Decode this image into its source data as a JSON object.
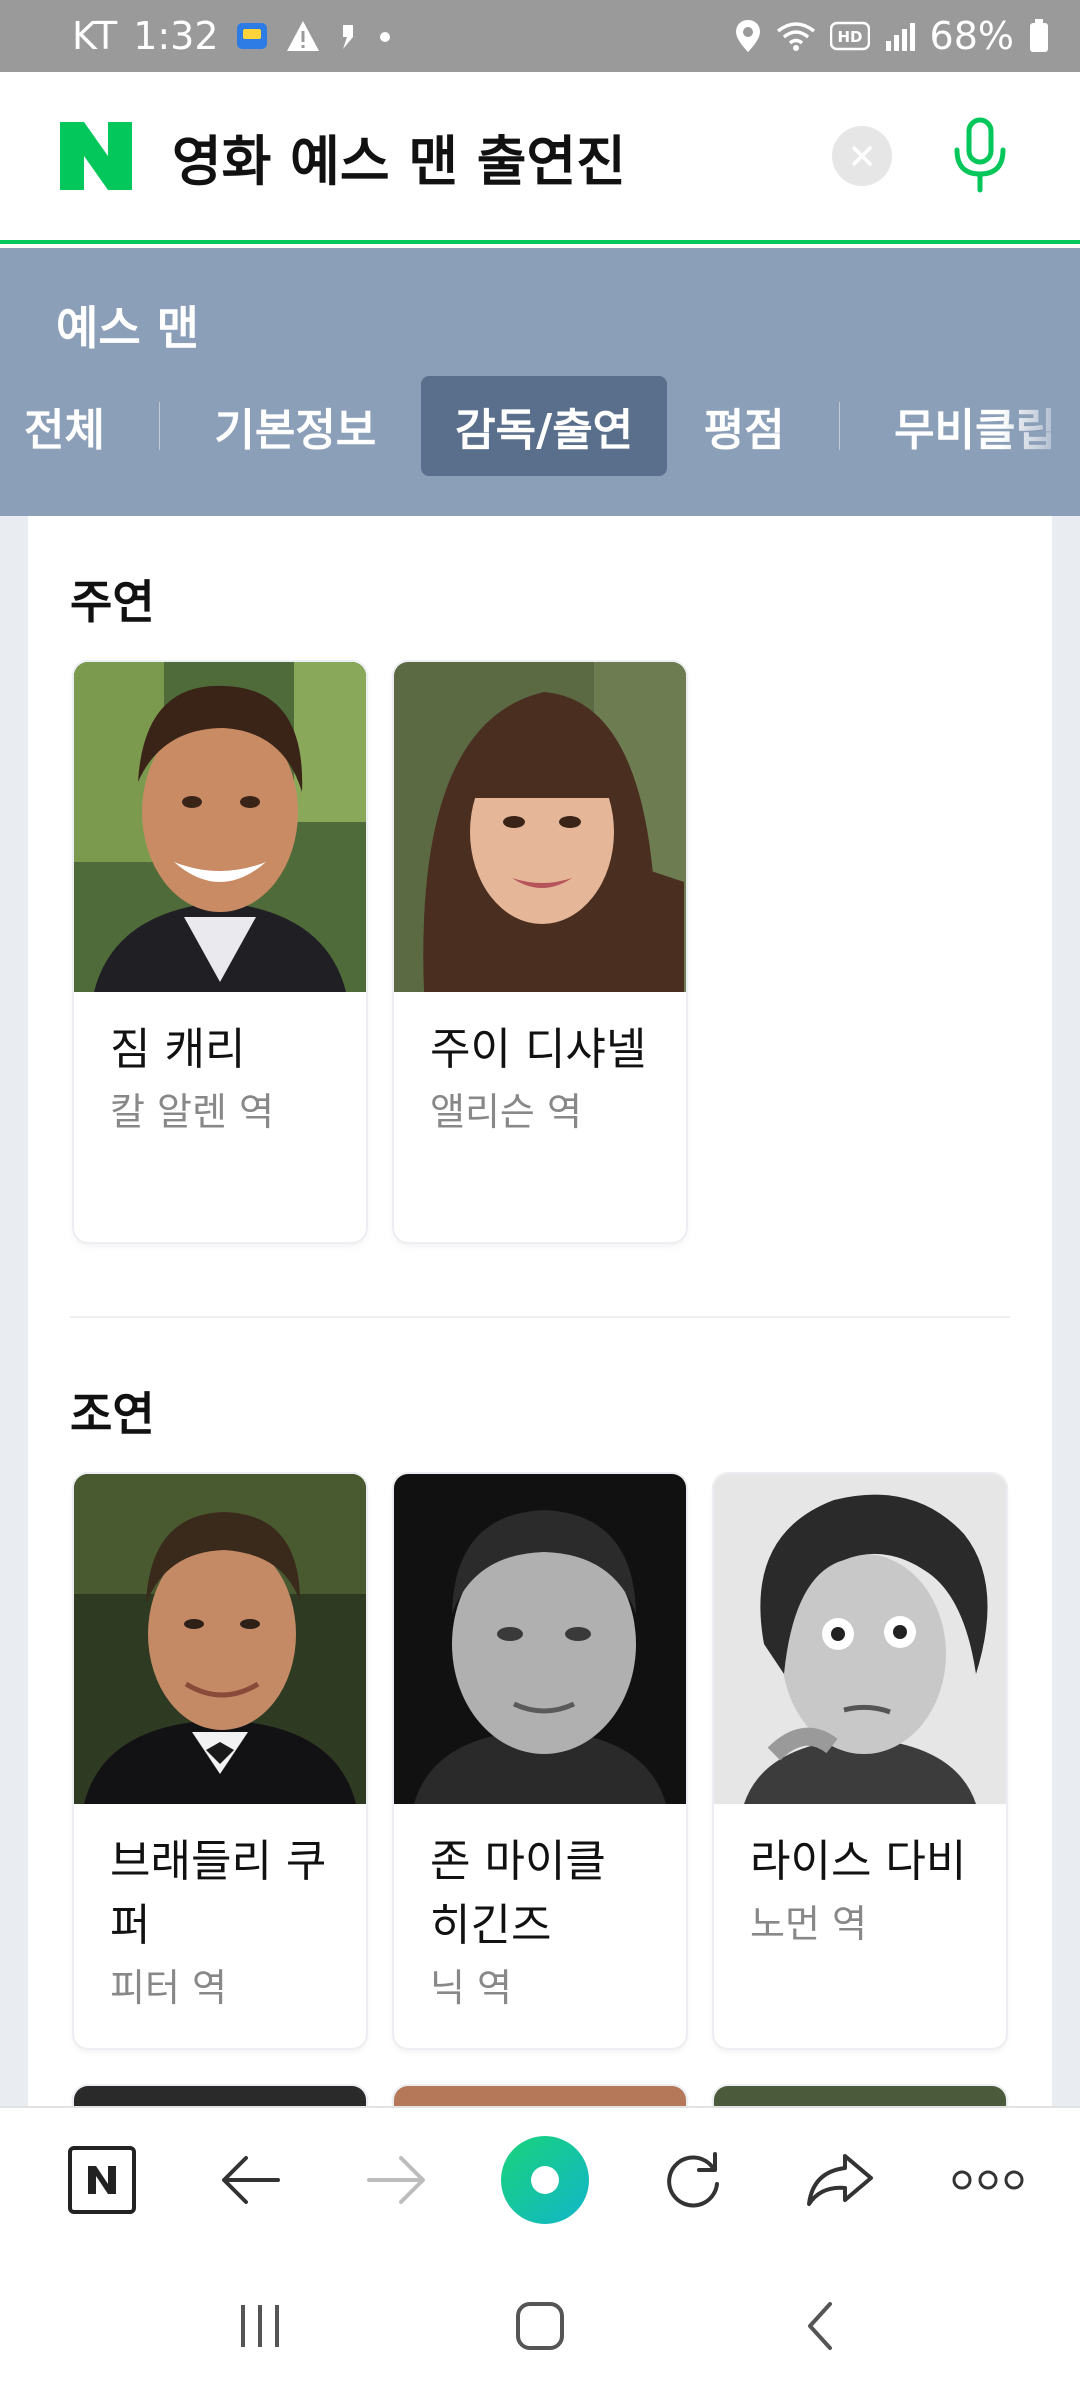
{
  "status_bar": {
    "carrier": "KT",
    "time": "1:32",
    "battery": "68%",
    "icons": [
      "messenger-icon",
      "warning-icon",
      "notification-icon",
      "dot-icon",
      "location-icon",
      "wifi-icon",
      "hd-icon",
      "signal-icon",
      "battery-icon"
    ]
  },
  "search": {
    "logo": "N",
    "query": "영화 예스 맨 출연진",
    "accent": "#03c75a"
  },
  "movie": {
    "title": "예스 맨",
    "tabs": [
      {
        "label": "전체",
        "active": false
      },
      {
        "label": "기본정보",
        "active": false
      },
      {
        "label": "감독/출연",
        "active": true
      },
      {
        "label": "평점",
        "active": false
      },
      {
        "label": "무비클립",
        "active": false
      }
    ],
    "panel_color": "#8c9fb8",
    "active_tab_color": "#5a6f8c"
  },
  "sections": {
    "lead": {
      "title": "주연",
      "cast": [
        {
          "name": "짐 캐리",
          "role": "칼 알렌 역",
          "photo": "portrait-jim-carrey"
        },
        {
          "name": "주이 디샤넬",
          "role": "앨리슨 역",
          "photo": "portrait-zooey-deschanel"
        }
      ]
    },
    "supporting": {
      "title": "조연",
      "cast": [
        {
          "name": "브래들리 쿠퍼",
          "role": "피터 역",
          "photo": "portrait-bradley-cooper"
        },
        {
          "name": "존 마이클 히긴즈",
          "role": "닉 역",
          "photo": "portrait-john-michael-higgins"
        },
        {
          "name": "라이스 다비",
          "role": "노먼 역",
          "photo": "portrait-rhys-darby"
        }
      ]
    }
  },
  "toolbar": {
    "buttons": [
      "naver-home-icon",
      "back-arrow-icon",
      "forward-arrow-icon",
      "green-dot-icon",
      "refresh-icon",
      "share-icon",
      "more-icon"
    ]
  },
  "system_nav": {
    "buttons": [
      "recent-apps-icon",
      "home-icon",
      "back-icon"
    ]
  }
}
